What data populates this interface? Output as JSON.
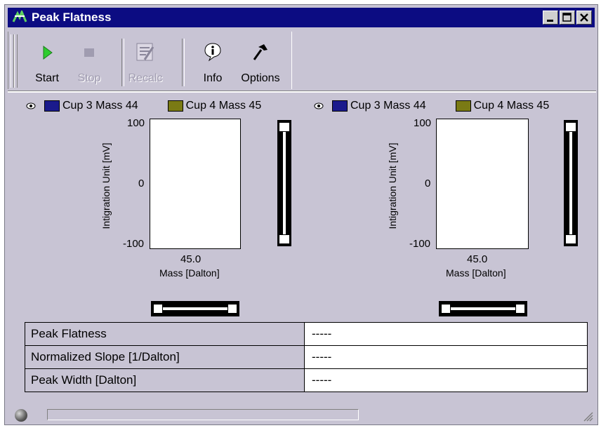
{
  "window": {
    "title": "Peak Flatness",
    "icon": "peak-app-icon",
    "controls": [
      "minimize",
      "maximize",
      "close"
    ]
  },
  "toolbar": {
    "start_label": "Start",
    "stop_label": "Stop",
    "recalc_label": "Recalc",
    "info_label": "Info",
    "options_label": "Options",
    "icons": {
      "start": "play-icon",
      "stop": "stop-icon",
      "recalc": "calculator-icon",
      "info": "info-icon",
      "options": "hammer-icon"
    },
    "start_color": "#2ecc2e"
  },
  "panels": [
    {
      "legend": [
        {
          "label": "Cup 3 Mass 44",
          "color": "#1a1a8c"
        },
        {
          "label": "Cup 4 Mass 45",
          "color": "#7a7a14"
        }
      ],
      "ylabel": "Intigration Unit [mV]",
      "yticks": [
        "100",
        "0",
        "-100"
      ],
      "xtick": "45.0",
      "xlabel": "Mass [Dalton]"
    },
    {
      "legend": [
        {
          "label": "Cup 3 Mass 44",
          "color": "#1a1a8c"
        },
        {
          "label": "Cup 4 Mass 45",
          "color": "#7a7a14"
        }
      ],
      "ylabel": "Intigration Unit [mV]",
      "yticks": [
        "100",
        "0",
        "-100"
      ],
      "xtick": "45.0",
      "xlabel": "Mass [Dalton]"
    }
  ],
  "results": [
    {
      "label": "Peak Flatness",
      "value": "-----"
    },
    {
      "label": "Normalized Slope [1/Dalton]",
      "value": "-----"
    },
    {
      "label": "Peak Width [Dalton]",
      "value": "-----"
    }
  ],
  "colors": {
    "titlebar": "#0c0c82",
    "window_bg": "#c8c4d4"
  }
}
